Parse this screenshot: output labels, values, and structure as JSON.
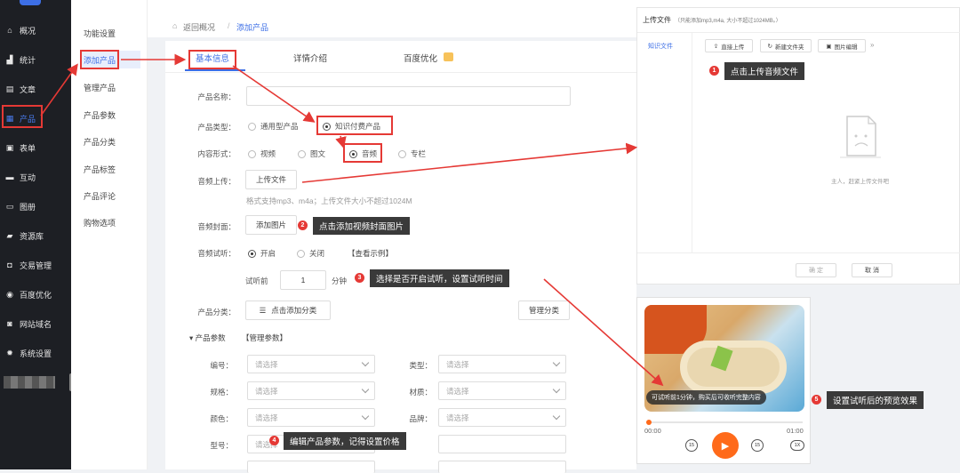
{
  "sidebar": {
    "items": [
      {
        "label": "概况",
        "icon": "home-icon"
      },
      {
        "label": "统计",
        "icon": "chart-icon"
      },
      {
        "label": "文章",
        "icon": "article-icon"
      },
      {
        "label": "产品",
        "icon": "grid-icon",
        "active": true
      },
      {
        "label": "表单",
        "icon": "form-icon"
      },
      {
        "label": "互动",
        "icon": "chat-icon"
      },
      {
        "label": "图册",
        "icon": "album-icon"
      },
      {
        "label": "资源库",
        "icon": "folder-icon"
      },
      {
        "label": "交易管理",
        "icon": "trade-icon"
      },
      {
        "label": "百度优化",
        "icon": "seo-icon"
      },
      {
        "label": "网站域名",
        "icon": "globe-icon"
      },
      {
        "label": "系统设置",
        "icon": "gear-icon"
      }
    ]
  },
  "subnav": {
    "items": [
      "功能设置",
      "添加产品",
      "管理产品",
      "产品参数",
      "产品分类",
      "产品标签",
      "产品评论",
      "购物选项"
    ]
  },
  "breadcrumb": {
    "back": "返回概况",
    "sep": "/",
    "current": "添加产品"
  },
  "tabs": [
    "基本信息",
    "详情介绍",
    "百度优化"
  ],
  "form": {
    "name_label": "产品名称：",
    "type_label": "产品类型：",
    "type_opt1": "通用型产品",
    "type_opt2": "知识付费产品",
    "content_label": "内容形式：",
    "content_opts": [
      "视频",
      "图文",
      "音频",
      "专栏"
    ],
    "audio_label": "音频上传：",
    "audio_btn": "上传文件",
    "audio_hint": "格式支持mp3、m4a；上传文件大小不超过1024M",
    "cover_label": "音频封面：",
    "cover_btn": "添加图片",
    "trial_label": "音频试听：",
    "trial_on": "开启",
    "trial_off": "关闭",
    "trial_example": "【查看示例】",
    "trial_before": "试听前",
    "trial_value": "1",
    "trial_unit": "分钟",
    "cat_label": "产品分类：",
    "cat_btn": "点击添加分类",
    "cat_manage": "管理分类",
    "params_label": "产品参数",
    "params_manage": "【管理参数】",
    "placeholder": "请选择",
    "param_fields": [
      {
        "left": "编号：",
        "right": "类型："
      },
      {
        "left": "规格：",
        "right": "材质："
      },
      {
        "left": "颜色：",
        "right": "品牌："
      },
      {
        "left": "型号：",
        "right": ""
      }
    ]
  },
  "tips": {
    "t1": "点击上传音频文件",
    "t2": "点击添加视频封面图片",
    "t3": "选择是否开启试听，设置试听时间",
    "t4": "编辑产品参数，记得设置价格",
    "t5": "设置试听后的预览效果"
  },
  "upload": {
    "title": "上传文件",
    "hint": "（只能添加mp3,m4a, 大小不超过1024MB。）",
    "side_tab": "知识文件",
    "btn_direct": "直接上传",
    "btn_newfolder": "新建文件夹",
    "btn_image": "图片编辑",
    "more": "»",
    "empty": "主人，赶紧上传文件吧",
    "ok": "确 定",
    "cancel": "取 消"
  },
  "player": {
    "caption": "可试听前1分钟，购买后可收听完整内容",
    "time_start": "00:00",
    "time_end": "01:00",
    "back15": "15",
    "fwd15": "15",
    "speed": "1X"
  },
  "colors": {
    "accent": "#4a7cf0",
    "annotation": "#e53935",
    "sidebar": "#1d1f24",
    "play": "#ff6a1a"
  }
}
